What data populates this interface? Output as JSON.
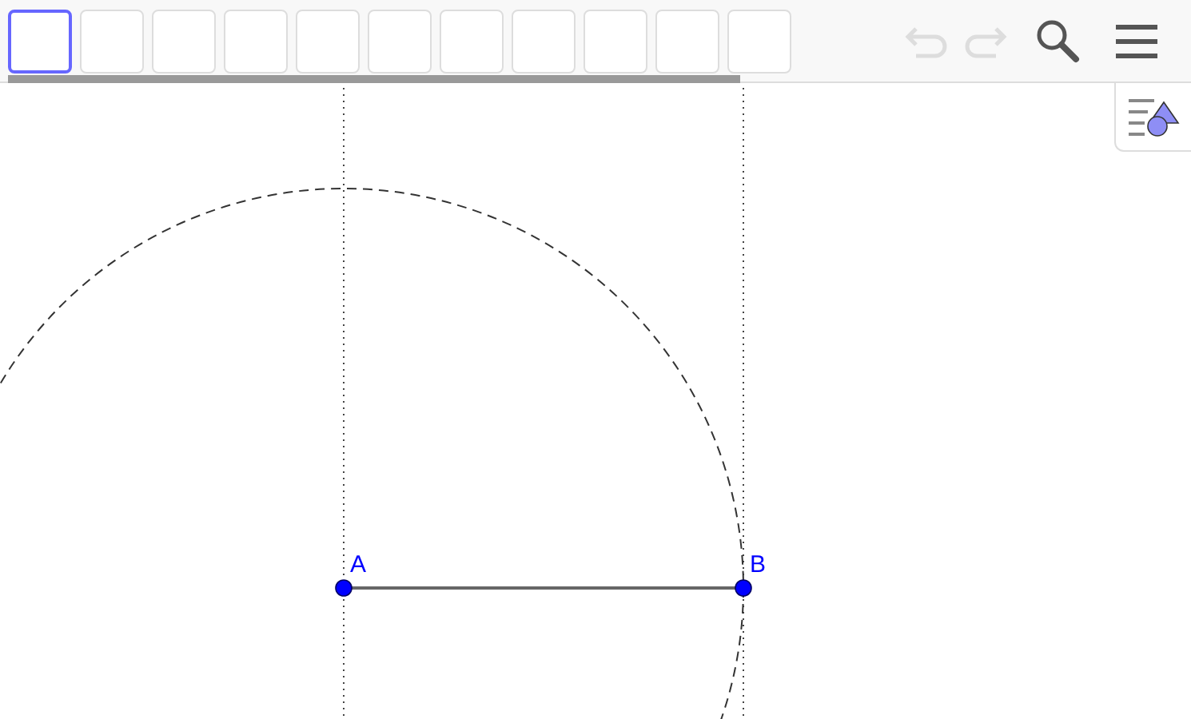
{
  "toolbar": {
    "tools": [
      {
        "selected": true
      },
      {
        "selected": false
      },
      {
        "selected": false
      },
      {
        "selected": false
      },
      {
        "selected": false
      },
      {
        "selected": false
      },
      {
        "selected": false
      },
      {
        "selected": false
      },
      {
        "selected": false
      },
      {
        "selected": false
      },
      {
        "selected": false
      }
    ],
    "undo": {
      "disabled": true
    },
    "redo": {
      "disabled": true
    }
  },
  "canvas": {
    "points": [
      {
        "label": "A"
      },
      {
        "label": "B"
      }
    ]
  }
}
